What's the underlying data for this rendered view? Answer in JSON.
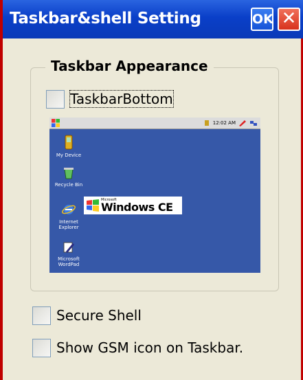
{
  "window": {
    "title": "Taskbar&shell Setting",
    "ok_label": "OK",
    "close_label": "✕"
  },
  "group": {
    "title": "Taskbar Appearance",
    "taskbar_bottom": {
      "label": "TaskbarBottom",
      "checked": false
    }
  },
  "preview": {
    "clock": "12:02 AM",
    "icons": [
      {
        "label": "My Device"
      },
      {
        "label": "Recycle Bin"
      },
      {
        "label": "Internet Explorer"
      },
      {
        "label": "Microsoft WordPad"
      }
    ],
    "logo_small": "Microsoft",
    "logo_big": "Windows CE"
  },
  "options": {
    "secure_shell": {
      "label": "Secure Shell",
      "checked": false
    },
    "show_gsm": {
      "label": "Show GSM icon on Taskbar.",
      "checked": false
    }
  },
  "colors": {
    "titlebar": "#0a3fc8",
    "frame_border": "#c00000",
    "desktop": "#3658a8",
    "dialog_bg": "#ece9d8"
  }
}
